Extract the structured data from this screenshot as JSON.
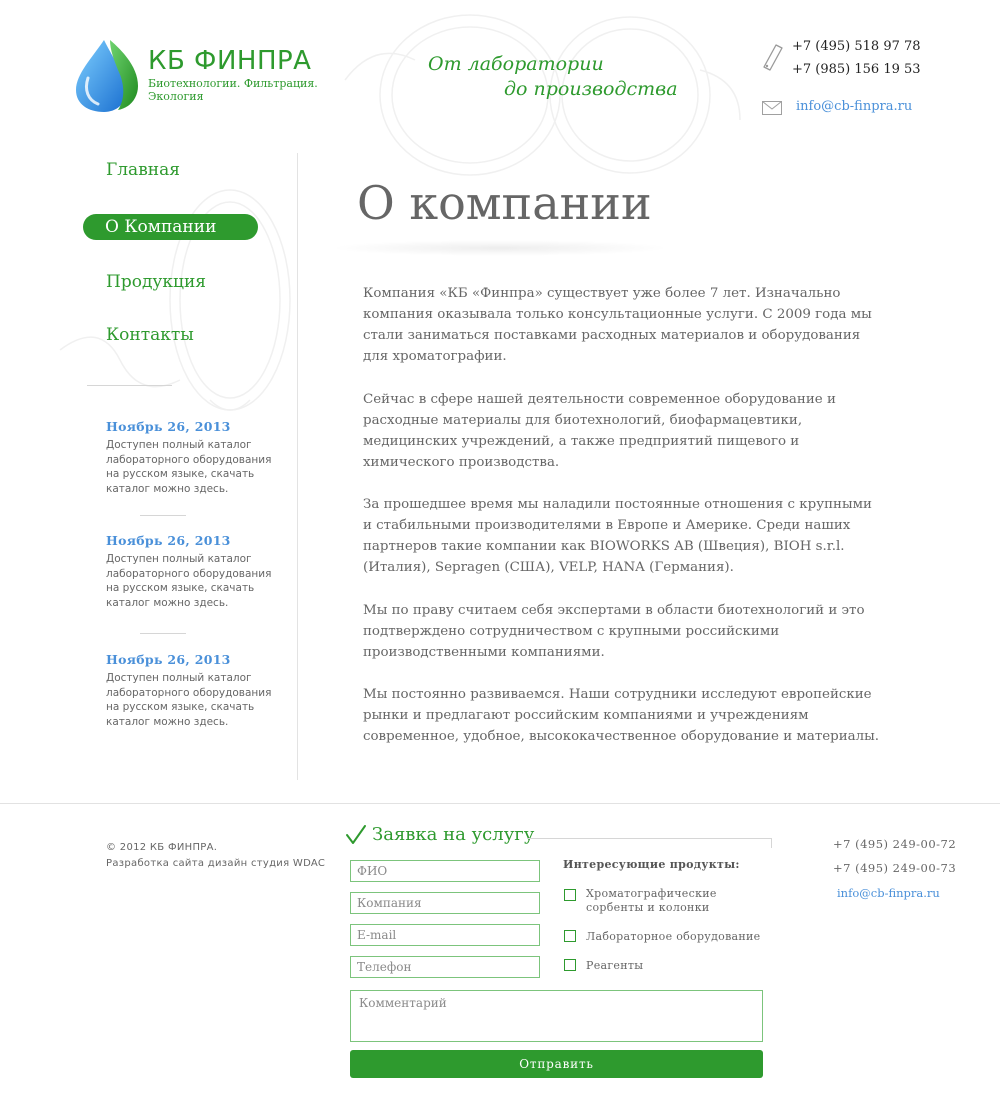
{
  "header": {
    "brand_name": "КБ ФИНПРА",
    "brand_tagline": "Биотехнологии. Фильтрация. Экология",
    "slogan_line1": "От лаборатории",
    "slogan_line2": "до производства",
    "phone1": "+7 (495) 518 97 78",
    "phone2": "+7 (985) 156 19 53",
    "email": "info@cb-finpra.ru"
  },
  "nav": {
    "items": [
      {
        "label": "Главная"
      },
      {
        "label": "О Компании"
      },
      {
        "label": "Продукция"
      },
      {
        "label": "Контакты"
      }
    ],
    "active_index": 1
  },
  "news": [
    {
      "date": "Ноябрь 26, 2013",
      "text": "Доступен полный каталог лабораторного оборудования на русском языке, скачать каталог можно здесь."
    },
    {
      "date": "Ноябрь 26, 2013",
      "text": "Доступен полный каталог лабораторного оборудования на русском языке, скачать каталог можно здесь."
    },
    {
      "date": "Ноябрь 26, 2013",
      "text": "Доступен полный каталог лабораторного оборудования на русском языке, скачать каталог можно здесь."
    }
  ],
  "main": {
    "title": "О компании",
    "paragraphs": [
      "Компания «КБ «Финпра» существует уже более 7 лет. Изначально компания оказывала только консультационные услуги. С 2009 года мы стали заниматься поставками расходных материалов и оборудования для хроматографии.",
      "Сейчас в сфере нашей деятельности современное оборудование и расходные материалы для биотехнологий, биофармацевтики, медицинских учреждений, а также предприятий пищевого и химического производства.",
      "За прошедшее время мы наладили постоянные отношения с крупными и стабильными производителями в Европе и Америке. Среди наших партнеров такие компании как BIOWORKS AB (Швеция), BIOH s.r.l. (Италия), Sepragen (США), VELP, HANA (Германия).",
      "Мы по праву считаем себя экспертами в области биотехнологий и это подтверждено сотрудничеством с крупными российскими производственными компаниями.",
      "Мы постоянно развиваемся. Наши сотрудники исследуют европейские рынки и предлагают российским компаниями и учреждениям современное, удобное, высококачественное оборудование и материалы."
    ]
  },
  "footer": {
    "copyright": "© 2012 КБ ФИНПРА.",
    "studio": "Разработка сайта дизайн студия WDAC",
    "phone1": "+7 (495) 249-00-72",
    "phone2": "+7 (495) 249-00-73",
    "email": "info@cb-finpra.ru"
  },
  "form": {
    "title": "Заявка на услугу",
    "placeholders": {
      "name": "ФИО",
      "company": "Компания",
      "email": "E-mail",
      "phone": "Телефон",
      "comment": "Комментарий"
    },
    "products_title": "Интересующие продукты:",
    "products": [
      {
        "label": "Хроматографические сорбенты и колонки",
        "checked": false
      },
      {
        "label": "Лабораторное оборудование",
        "checked": false
      },
      {
        "label": "Реагенты",
        "checked": false
      }
    ],
    "submit_label": "Отправить"
  },
  "colors": {
    "brand_green": "#2e9a2e",
    "link_blue": "#4a90d9",
    "text_gray": "#666666"
  },
  "icons": [
    "logo-drop-icon",
    "phone-icon",
    "mail-icon",
    "checkmark-icon"
  ]
}
